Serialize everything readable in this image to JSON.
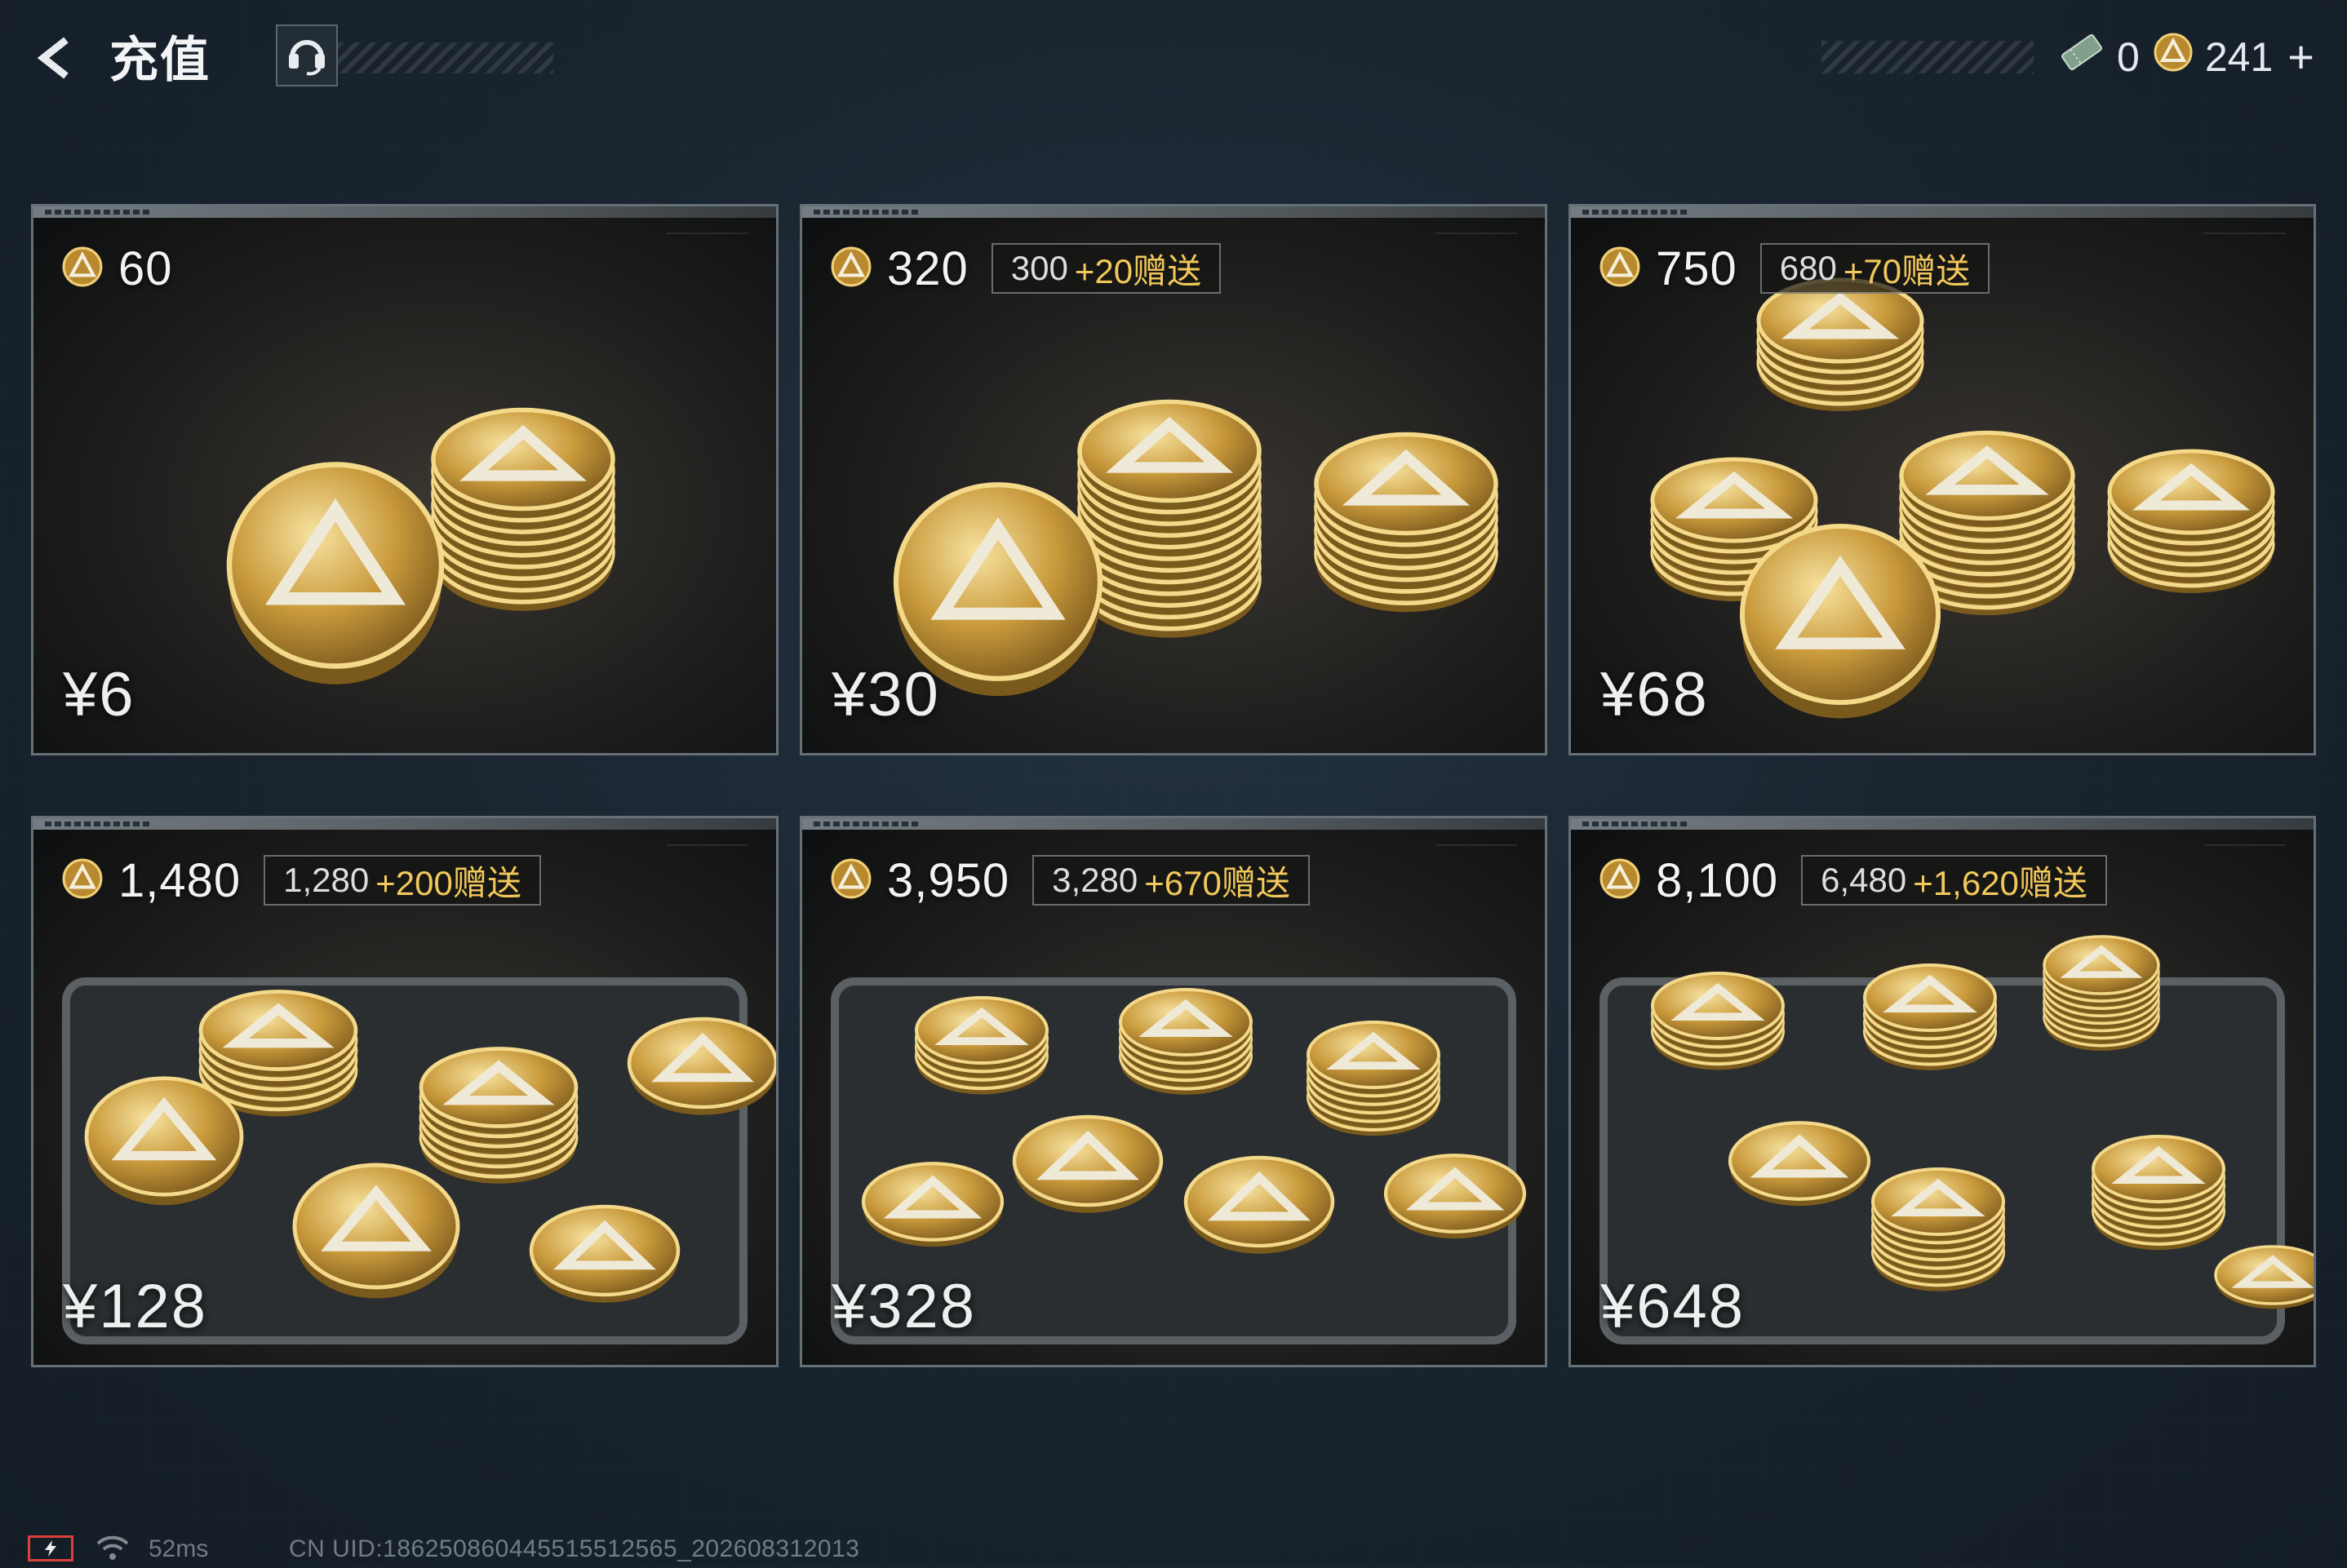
{
  "header": {
    "title": "充值",
    "back_icon": "back-arrow-icon",
    "support_icon": "headset-icon",
    "currencies": [
      {
        "icon": "ticket-icon",
        "value": "0"
      },
      {
        "icon": "delta-coin-icon",
        "value": "241"
      }
    ],
    "add_label": "+"
  },
  "packages": [
    {
      "coins": "60",
      "bonus_base": "",
      "bonus_extra": "",
      "price": "¥6"
    },
    {
      "coins": "320",
      "bonus_base": "300",
      "bonus_extra": "+20赠送",
      "price": "¥30"
    },
    {
      "coins": "750",
      "bonus_base": "680",
      "bonus_extra": "+70赠送",
      "price": "¥68"
    },
    {
      "coins": "1,480",
      "bonus_base": "1,280",
      "bonus_extra": "+200赠送",
      "price": "¥128"
    },
    {
      "coins": "3,950",
      "bonus_base": "3,280",
      "bonus_extra": "+670赠送",
      "price": "¥328"
    },
    {
      "coins": "8,100",
      "bonus_base": "6,480",
      "bonus_extra": "+1,620赠送",
      "price": "¥648"
    }
  ],
  "status": {
    "ping": "52ms",
    "uid": "CN UID:18625086044551551256​5_202608312013"
  },
  "colors": {
    "accent_gold": "#f2c85a",
    "battery_red": "#d9413a",
    "background": "#1a2530"
  }
}
